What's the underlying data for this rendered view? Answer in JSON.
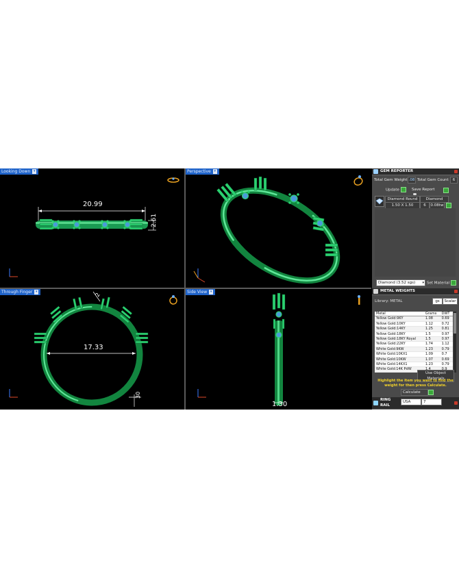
{
  "viewports": [
    {
      "id": "looking-down",
      "label": "Looking Down",
      "dimensions": [
        "20.99",
        "2.61"
      ]
    },
    {
      "id": "perspective",
      "label": "Perspective",
      "dimensions": []
    },
    {
      "id": "through-finger",
      "label": "Through Finger",
      "dimensions": [
        "17.33",
        "2",
        "30"
      ]
    },
    {
      "id": "side-view",
      "label": "Side View",
      "dimensions": [
        "1.30"
      ]
    }
  ],
  "gem_reporter": {
    "title": "GEM REPORTER",
    "total_weight_label": "Total Gem Weight",
    "total_weight_value": ".08",
    "total_count_label": "Total Gem Count",
    "total_count_value": "6",
    "update_label": "Update",
    "save_report_label": "Save Report",
    "gem": {
      "shape": "Diamond Round",
      "material": "Diamond",
      "size": "1.50 X 1.50",
      "count": "6",
      "weight": "0.08tw"
    },
    "material_select": "Diamond  (3.52 sgs)",
    "set_material_label": "Set Material"
  },
  "metal_weights": {
    "title": "METAL WEIGHTS",
    "library_label": "Library: METAL",
    "unit_select": "gs",
    "unit2_select": "Scalar",
    "columns": [
      "Metal",
      "Grams",
      "DWT"
    ],
    "rows": [
      [
        "Yellow Gold:9KY",
        "1.08",
        "0.69"
      ],
      [
        "Yellow Gold:10KY",
        "1.12",
        "0.72"
      ],
      [
        "Yellow Gold:14KY",
        "1.25",
        "0.81"
      ],
      [
        "Yellow Gold:18KY",
        "1.5",
        "0.97"
      ],
      [
        "Yellow Gold:18KY Royal",
        "1.5",
        "0.97"
      ],
      [
        "Yellow Gold:22KY",
        "1.74",
        "1.12"
      ],
      [
        "White Gold:9KW",
        "1.23",
        "0.79"
      ],
      [
        "White Gold:10KX1",
        "1.09",
        "0.7"
      ],
      [
        "White Gold:10KW",
        "1.07",
        "0.69"
      ],
      [
        "White Gold:14KX1",
        "1.23",
        "0.79"
      ],
      [
        "White Gold:14K PdW",
        "1.4",
        "0.9"
      ]
    ],
    "use_object_label": "Use Object Materials",
    "hint": "Highlight the item you want to find the weight for then press Calculate.",
    "calculate_label": "Calculate"
  },
  "ring_rail": {
    "title": "RING RAIL",
    "standard_select": "USA",
    "size_select": "7"
  },
  "colors": {
    "ring": "#1ea85a",
    "ring_light": "#6ef0a0",
    "dimension": "#ffffff",
    "label_bg": "#1f63c9"
  }
}
